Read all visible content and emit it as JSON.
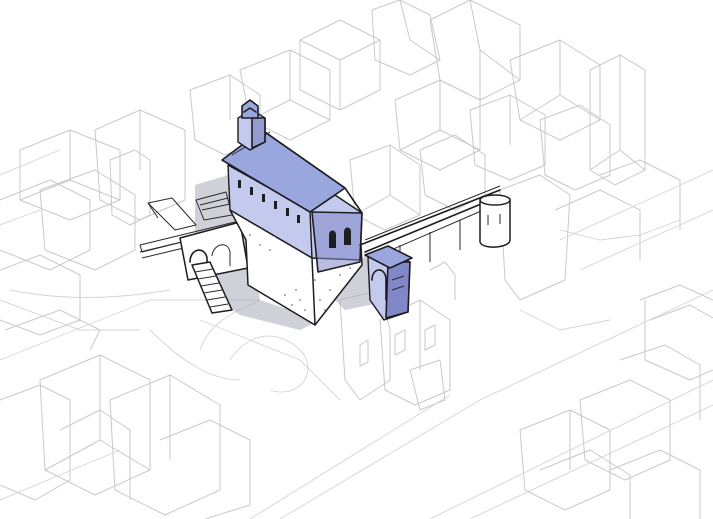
{
  "drawing": {
    "subject": "",
    "highlight_color": "#9aa6de",
    "shade_color": "#8088c8",
    "context_line_color": "#c9c9cc",
    "ink_color": "#1d1d22",
    "shadow_color": "#a9a9b8"
  }
}
